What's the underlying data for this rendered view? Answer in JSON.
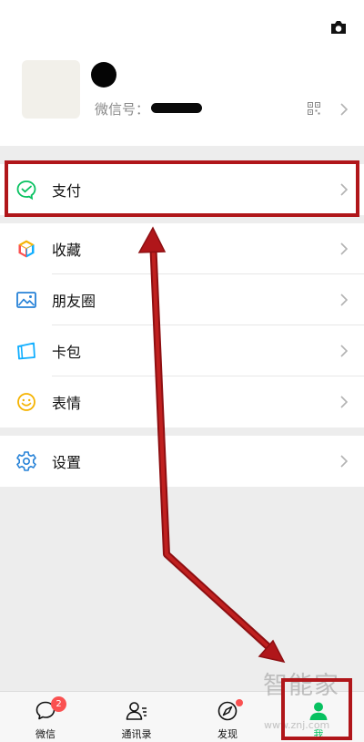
{
  "profile": {
    "wechat_id_label": "微信号："
  },
  "menu": {
    "pay": "支付",
    "favorites": "收藏",
    "moments": "朋友圈",
    "cards": "卡包",
    "stickers": "表情",
    "settings": "设置"
  },
  "tabbar": {
    "chats": "微信",
    "chats_badge": "2",
    "contacts": "通讯录",
    "discover": "发现",
    "me": "我"
  },
  "watermark": {
    "brand": "智能家",
    "url": "www.znj.com"
  },
  "colors": {
    "accent": "#07c160",
    "annotation": "#b0161a",
    "badge": "#fa5151"
  }
}
